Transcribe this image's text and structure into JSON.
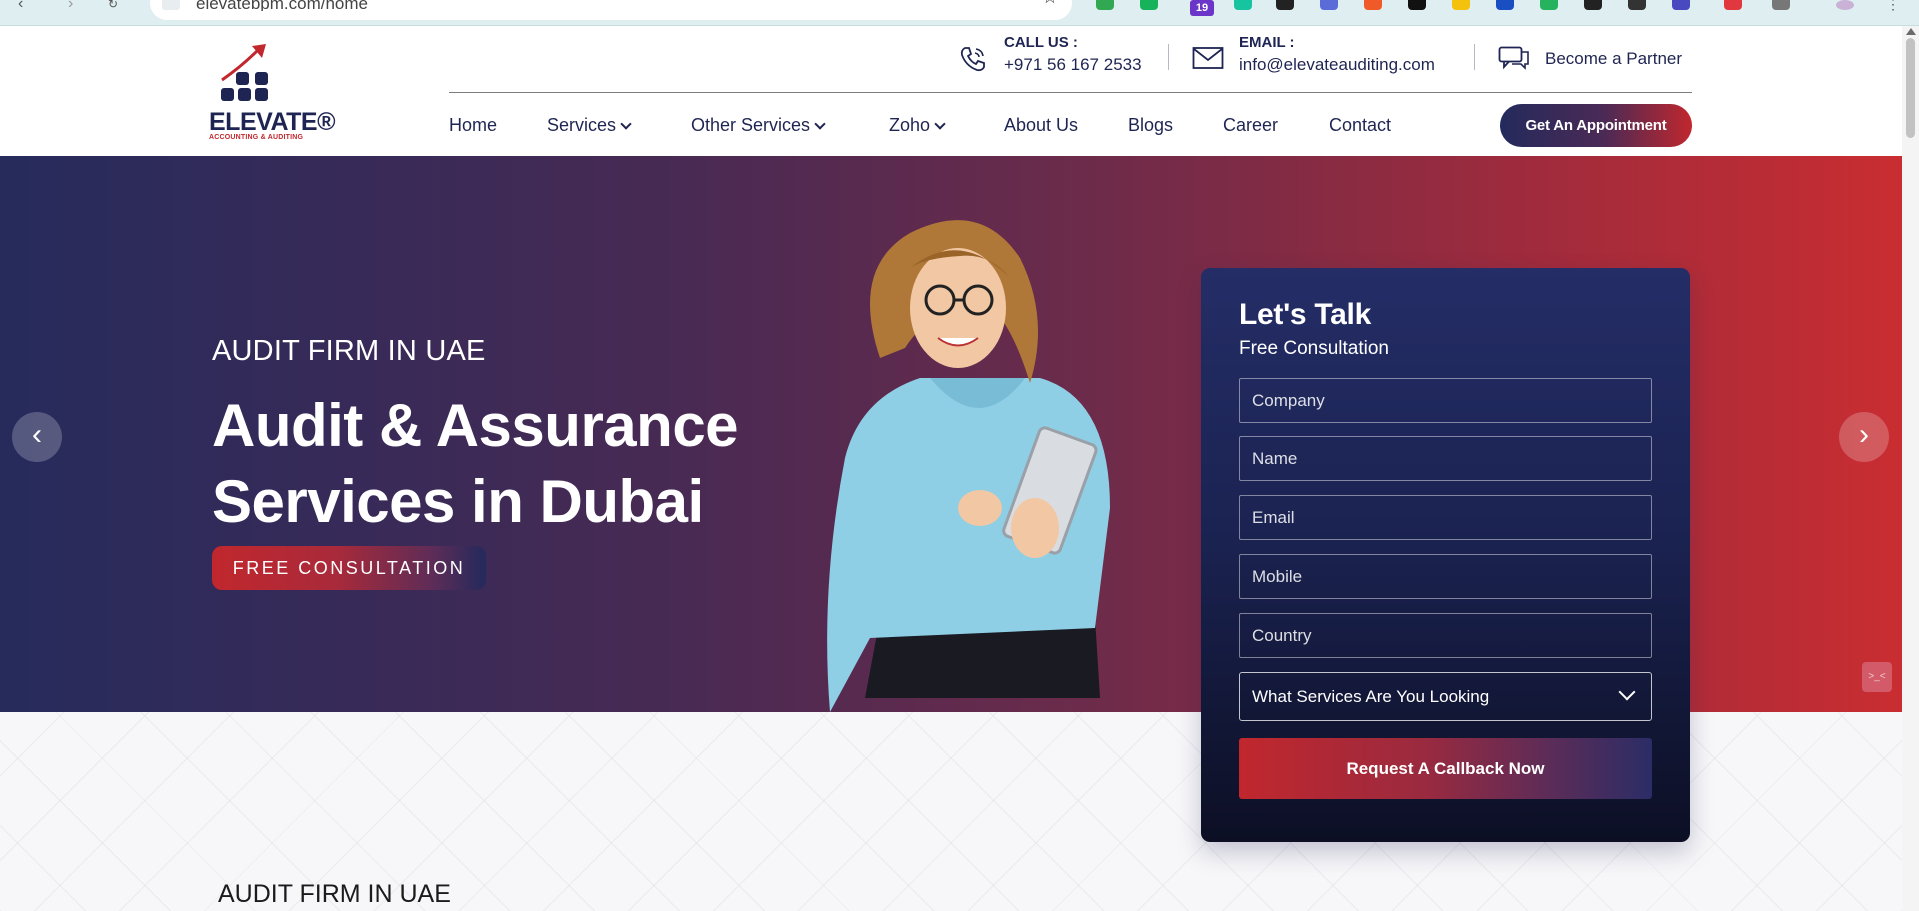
{
  "browser": {
    "url": "elevatebpm.com/home",
    "extension_badge": "19"
  },
  "header": {
    "logo_text": "ELEVATE®",
    "logo_sub": "ACCOUNTING & AUDITING",
    "call_label": "CALL US :",
    "call_value": "+971 56 167 2533",
    "email_label": "EMAIL :",
    "email_value": "info@elevateauditing.com",
    "partner_label": "Become a Partner"
  },
  "nav": {
    "items": [
      "Home",
      "Services",
      "Other Services",
      "Zoho",
      "About Us",
      "Blogs",
      "Career",
      "Contact"
    ],
    "cta": "Get An Appointment"
  },
  "hero": {
    "eyebrow": "AUDIT FIRM IN UAE",
    "title": "Audit & Assurance Services in Dubai",
    "button": "FREE CONSULTATION"
  },
  "form": {
    "title": "Let's Talk",
    "subtitle": "Free Consultation",
    "placeholders": {
      "company": "Company",
      "name": "Name",
      "email": "Email",
      "mobile": "Mobile",
      "country": "Country"
    },
    "select_value": "What Services Are You Looking",
    "submit": "Request A Callback Now"
  },
  "section": {
    "eyebrow": "AUDIT FIRM IN UAE"
  },
  "colors": {
    "navy": "#1f2552",
    "red": "#c1272d",
    "hero_left": "#262b5c",
    "hero_right": "#c92d31"
  },
  "icons": [
    "back-icon",
    "forward-icon",
    "reload-icon",
    "bookmark-star-icon",
    "phone-icon",
    "mail-icon",
    "chat-icon",
    "chevron-down-icon",
    "chevron-left-icon",
    "chevron-right-icon"
  ]
}
